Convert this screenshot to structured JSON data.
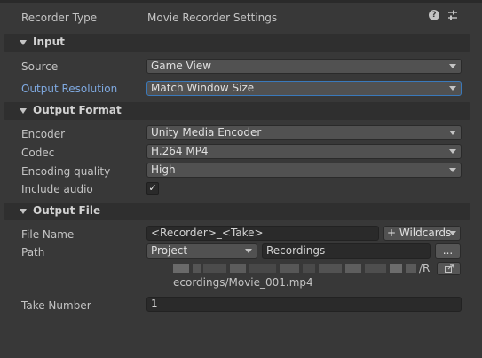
{
  "header": {
    "recorder_type_label": "Recorder Type",
    "recorder_type_value": "Movie Recorder Settings",
    "help_icon": "help-icon",
    "settings_icon": "preset-sliders-icon"
  },
  "input": {
    "section_title": "Input",
    "source_label": "Source",
    "source_value": "Game View",
    "resolution_label": "Output Resolution",
    "resolution_value": "Match Window Size"
  },
  "output_format": {
    "section_title": "Output Format",
    "encoder_label": "Encoder",
    "encoder_value": "Unity Media Encoder",
    "codec_label": "Codec",
    "codec_value": "H.264 MP4",
    "quality_label": "Encoding quality",
    "quality_value": "High",
    "audio_label": "Include audio",
    "audio_checked": true,
    "audio_check_glyph": "✓"
  },
  "output_file": {
    "section_title": "Output File",
    "file_name_label": "File Name",
    "file_name_value": "<Recorder>_<Take>",
    "wildcards_label": "+ Wildcards",
    "path_label": "Path",
    "path_root_value": "Project",
    "path_folder_value": "Recordings",
    "browse_label": "...",
    "resolved_path_line1_suffix": "/R",
    "resolved_path_line2": "ecordings/Movie_001.mp4",
    "open_folder_icon": "open-external-icon"
  },
  "take": {
    "label": "Take Number",
    "value": "1"
  },
  "colors": {
    "background": "#383838",
    "section_bg": "#2f2f2f",
    "accent_label": "#7fa9e0",
    "focus_border": "#3a79bb",
    "field_bg": "#2a2a2a",
    "dropdown_bg": "#515151"
  }
}
